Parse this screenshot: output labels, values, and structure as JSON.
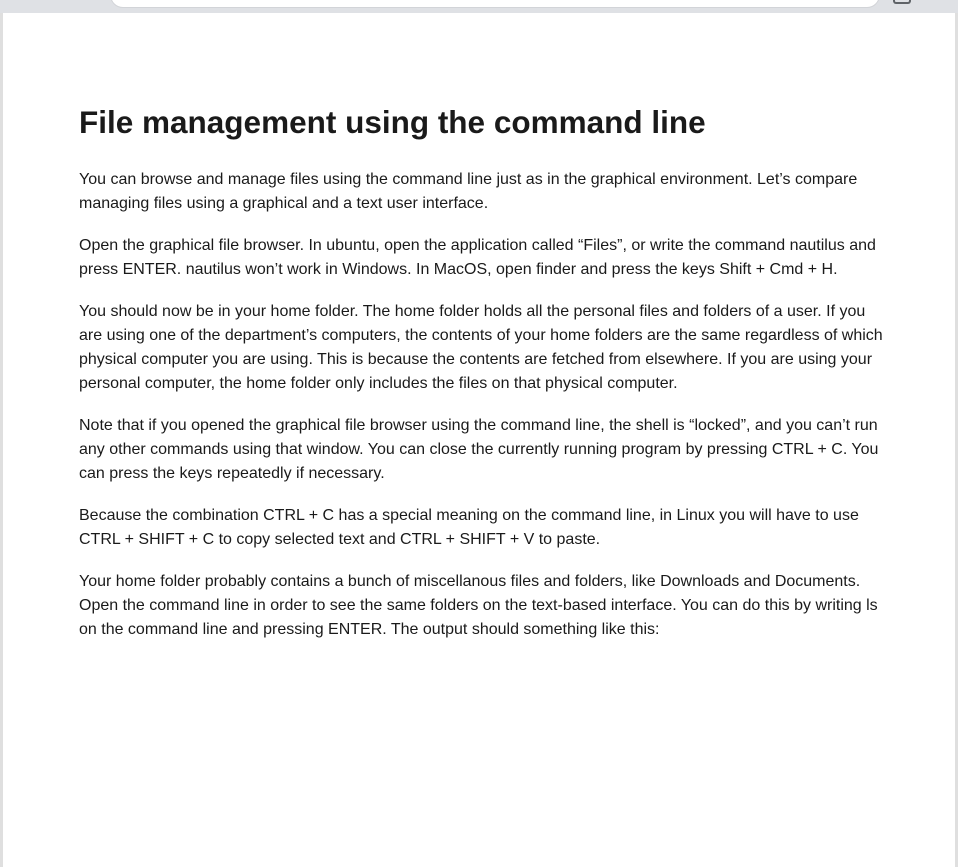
{
  "article": {
    "title": "File management using the command line",
    "paragraphs": [
      "You can browse and manage files using the command line just as in the graphical environment. Let’s compare managing files using a graphical and a text user interface.",
      "Open the graphical file browser. In ubuntu, open the application called “Files”, or write the command nautilus and press ENTER. nautilus won’t work in Windows. In MacOS, open finder and press the keys Shift + Cmd + H.",
      "You should now be in your home folder. The home folder holds all the personal files and folders of a user. If you are using one of the department’s computers, the contents of your home folders are the same regardless of which physical computer you are using. This is because the contents are fetched from elsewhere. If you are using your personal computer, the home folder only includes the files on that physical computer.",
      "Note that if you opened the graphical file browser using the command line, the shell is “locked”, and you can’t run any other commands using that window. You can close the currently running program by pressing CTRL + C. You can press the keys repeatedly if necessary.",
      "Because the combination CTRL + C has a special meaning on the command line, in Linux you will have to use CTRL + SHIFT + C to copy selected text and CTRL + SHIFT + V to paste.",
      "Your home folder probably contains a bunch of miscellanous files and folders, like Downloads and Documents. Open the command line in order to see the same folders on the text-based interface. You can do this by writing ls on the command line and pressing ENTER. The output should something like this:"
    ]
  }
}
